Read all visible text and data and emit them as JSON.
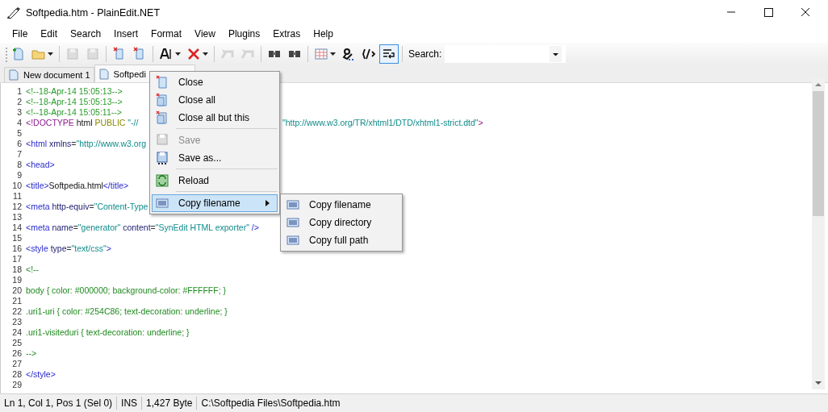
{
  "window": {
    "title": "Softpedia.htm - PlainEdit.NET"
  },
  "menubar": [
    "File",
    "Edit",
    "Search",
    "Insert",
    "Format",
    "View",
    "Plugins",
    "Extras",
    "Help"
  ],
  "toolbar": [
    {
      "kind": "button",
      "disabled": false,
      "pressed": false,
      "dropdown": false
    },
    {
      "kind": "button",
      "disabled": false,
      "pressed": false,
      "dropdown": true
    },
    {
      "kind": "separator"
    },
    {
      "kind": "button",
      "disabled": true,
      "pressed": false,
      "dropdown": false
    },
    {
      "kind": "button",
      "disabled": true,
      "pressed": false,
      "dropdown": false
    },
    {
      "kind": "separator"
    },
    {
      "kind": "button",
      "disabled": false,
      "pressed": false,
      "dropdown": false
    },
    {
      "kind": "button",
      "disabled": false,
      "pressed": false,
      "dropdown": false
    },
    {
      "kind": "separator"
    },
    {
      "kind": "button",
      "disabled": false,
      "pressed": false,
      "dropdown": true
    },
    {
      "kind": "button",
      "disabled": false,
      "pressed": false,
      "dropdown": true
    },
    {
      "kind": "separator"
    },
    {
      "kind": "button",
      "disabled": true,
      "pressed": false,
      "dropdown": false
    },
    {
      "kind": "button",
      "disabled": true,
      "pressed": false,
      "dropdown": false
    },
    {
      "kind": "separator"
    },
    {
      "kind": "button",
      "disabled": false,
      "pressed": false,
      "dropdown": false
    },
    {
      "kind": "button",
      "disabled": false,
      "pressed": false,
      "dropdown": false
    },
    {
      "kind": "separator"
    },
    {
      "kind": "button",
      "disabled": false,
      "pressed": false,
      "dropdown": true
    },
    {
      "kind": "button",
      "disabled": false,
      "pressed": false,
      "dropdown": false
    },
    {
      "kind": "button",
      "disabled": false,
      "pressed": false,
      "dropdown": false
    },
    {
      "kind": "button",
      "disabled": false,
      "pressed": true,
      "dropdown": false
    },
    {
      "kind": "separator"
    }
  ],
  "search": {
    "label": "Search:"
  },
  "tabs": [
    {
      "label": "New document 1",
      "selected": false
    },
    {
      "label": "Softpedi",
      "selected": true
    }
  ],
  "editor": {
    "lines": [
      {
        "n": "1",
        "tokens": [
          {
            "kind": "comment",
            "text": "<!--18-Apr-14 15:05:13-->"
          }
        ]
      },
      {
        "n": "2",
        "tokens": [
          {
            "kind": "comment",
            "text": "<!--18-Apr-14 15:05:13-->"
          }
        ]
      },
      {
        "n": "3",
        "tokens": [
          {
            "kind": "comment",
            "text": "<!--18-Apr-14 15:05:11-->"
          }
        ]
      },
      {
        "n": "4",
        "tokens": [
          {
            "kind": "doctype",
            "text": "<!DOCTYPE"
          },
          {
            "kind": "text",
            "text": " html "
          },
          {
            "kind": "keyword",
            "text": "PUBLIC"
          },
          {
            "kind": "string",
            "text": " \"-//"
          }
        ],
        "tail": [
          {
            "kind": "string",
            "text": "\"http://www.w3.org/TR/xhtml1/DTD/xhtml1-strict.dtd\""
          },
          {
            "kind": "doctype",
            "text": ">"
          }
        ]
      },
      {
        "n": "5"
      },
      {
        "n": "6",
        "tokens": [
          {
            "kind": "tag",
            "text": "<html"
          },
          {
            "kind": "attr",
            "text": " xmlns"
          },
          {
            "kind": "symbol",
            "text": "="
          },
          {
            "kind": "string",
            "text": "\"http://www.w3.org"
          }
        ]
      },
      {
        "n": "7"
      },
      {
        "n": "8",
        "tokens": [
          {
            "kind": "tag",
            "text": "<head>"
          }
        ]
      },
      {
        "n": "9"
      },
      {
        "n": "10",
        "tokens": [
          {
            "kind": "tag",
            "text": "<title>"
          },
          {
            "kind": "text",
            "text": "Softpedia.html"
          },
          {
            "kind": "tag",
            "text": "</title>"
          }
        ]
      },
      {
        "n": "11"
      },
      {
        "n": "12",
        "tokens": [
          {
            "kind": "tag",
            "text": "<meta"
          },
          {
            "kind": "attr",
            "text": " http-equiv"
          },
          {
            "kind": "symbol",
            "text": "="
          },
          {
            "kind": "string",
            "text": "\"Content-Type"
          }
        ]
      },
      {
        "n": "13"
      },
      {
        "n": "14",
        "tokens": [
          {
            "kind": "tag",
            "text": "<meta"
          },
          {
            "kind": "attr",
            "text": " name"
          },
          {
            "kind": "symbol",
            "text": "="
          },
          {
            "kind": "string",
            "text": "\"generator\""
          },
          {
            "kind": "attr",
            "text": " content"
          },
          {
            "kind": "symbol",
            "text": "="
          },
          {
            "kind": "string",
            "text": "\"SynEdit HTML exporter\""
          },
          {
            "kind": "tag",
            "text": " />"
          }
        ]
      },
      {
        "n": "15"
      },
      {
        "n": "16",
        "tokens": [
          {
            "kind": "tag",
            "text": "<style"
          },
          {
            "kind": "attr",
            "text": " type"
          },
          {
            "kind": "symbol",
            "text": "="
          },
          {
            "kind": "string",
            "text": "\"text/css\""
          },
          {
            "kind": "tag",
            "text": ">"
          }
        ]
      },
      {
        "n": "17"
      },
      {
        "n": "18",
        "tokens": [
          {
            "kind": "css",
            "text": "<!--"
          }
        ]
      },
      {
        "n": "19"
      },
      {
        "n": "20",
        "tokens": [
          {
            "kind": "css",
            "text": "body { color: #000000; background-color: #FFFFFF; }"
          }
        ]
      },
      {
        "n": "21"
      },
      {
        "n": "22",
        "tokens": [
          {
            "kind": "css",
            "text": ".uri1-uri { color: #254C86; text-decoration: underline; }"
          }
        ]
      },
      {
        "n": "23"
      },
      {
        "n": "24",
        "tokens": [
          {
            "kind": "css",
            "text": ".uri1-visiteduri { text-decoration: underline; }"
          }
        ]
      },
      {
        "n": "25"
      },
      {
        "n": "26",
        "tokens": [
          {
            "kind": "css",
            "text": "-->"
          }
        ]
      },
      {
        "n": "27"
      },
      {
        "n": "28",
        "tokens": [
          {
            "kind": "tag",
            "text": "</style>"
          }
        ]
      },
      {
        "n": "29"
      }
    ]
  },
  "context_menu": {
    "items": [
      {
        "kind": "item",
        "label": "Close",
        "disabled": false,
        "selected": false,
        "submenu": false
      },
      {
        "kind": "item",
        "label": "Close all",
        "disabled": false,
        "selected": false,
        "submenu": false
      },
      {
        "kind": "item",
        "label": "Close all but this",
        "disabled": false,
        "selected": false,
        "submenu": false
      },
      {
        "kind": "separator"
      },
      {
        "kind": "item",
        "label": "Save",
        "disabled": true,
        "selected": false,
        "submenu": false
      },
      {
        "kind": "item",
        "label": "Save as...",
        "disabled": false,
        "selected": false,
        "submenu": false
      },
      {
        "kind": "separator"
      },
      {
        "kind": "item",
        "label": "Reload",
        "disabled": false,
        "selected": false,
        "submenu": false
      },
      {
        "kind": "separator"
      },
      {
        "kind": "item",
        "label": "Copy filename",
        "disabled": false,
        "selected": true,
        "submenu": true
      }
    ],
    "submenu": [
      {
        "label": "Copy filename"
      },
      {
        "label": "Copy directory"
      },
      {
        "label": "Copy full path"
      }
    ]
  },
  "status_bar": [
    "Ln 1, Col 1, Pos 1 (Sel 0)",
    "INS",
    "1,427 Byte",
    "C:\\Softpedia Files\\Softpedia.htm"
  ]
}
